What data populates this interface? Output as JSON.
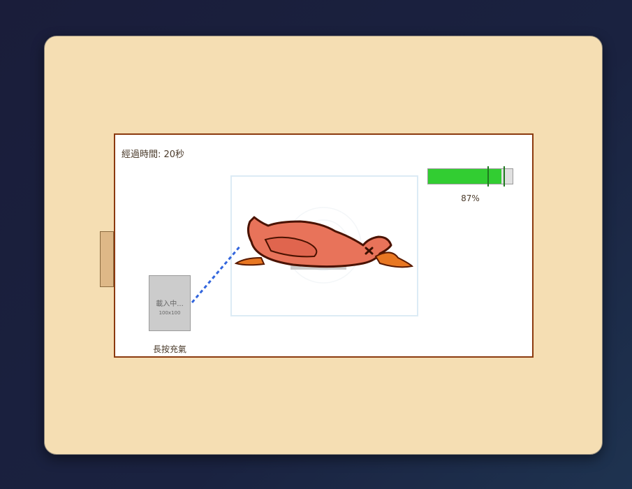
{
  "header": {
    "title": ""
  },
  "game": {
    "timer_text": "經過時間: 20秒",
    "pump": {
      "loading_text": "載入中...",
      "size_text": "100x100",
      "label": "長按充氣"
    },
    "gauge": {
      "percent_text": "87%",
      "fill_fraction": 0.87,
      "marker_fractions": [
        0.7,
        0.89
      ],
      "fill_color": "#32cd32",
      "marker_color": "#1f7a1f"
    },
    "duck": {
      "state": "deflated",
      "icon": "duck-knocked-out"
    }
  },
  "colors": {
    "device_bg": "#f5deb3",
    "panel_border": "#8b3a0f",
    "hose": "#3366dd"
  }
}
